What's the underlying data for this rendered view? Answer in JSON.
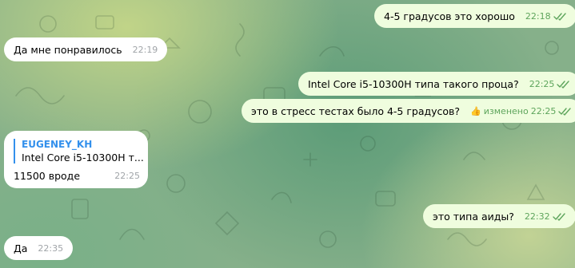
{
  "colors": {
    "incoming_bubble": "#ffffff",
    "outgoing_bubble": "#effdde",
    "accent": "#3390ec",
    "read_check": "#5ea55c"
  },
  "messages": [
    {
      "direction": "outgoing",
      "text": "4-5 градусов это хорошо",
      "time": "22:18",
      "status": "read"
    },
    {
      "direction": "incoming",
      "text": "Да мне понравилось",
      "time": "22:19"
    },
    {
      "direction": "outgoing",
      "text": "Intel Core i5-10300H типа такого проца?",
      "time": "22:25",
      "status": "read"
    },
    {
      "direction": "outgoing",
      "text": "это в стресс тестах было 4-5 градусов?",
      "time": "22:25",
      "edited_label": "изменено",
      "reaction_icon": "thumbs-up-icon",
      "status": "read"
    },
    {
      "direction": "incoming",
      "reply": {
        "author": "EUGENEY_KH",
        "quote": "Intel Core i5-10300H т..."
      },
      "text": "11500 вроде",
      "time": "22:25"
    },
    {
      "direction": "outgoing",
      "text": "это типа аиды?",
      "time": "22:32",
      "status": "read"
    },
    {
      "direction": "incoming",
      "text": "Да",
      "time": "22:35"
    }
  ]
}
